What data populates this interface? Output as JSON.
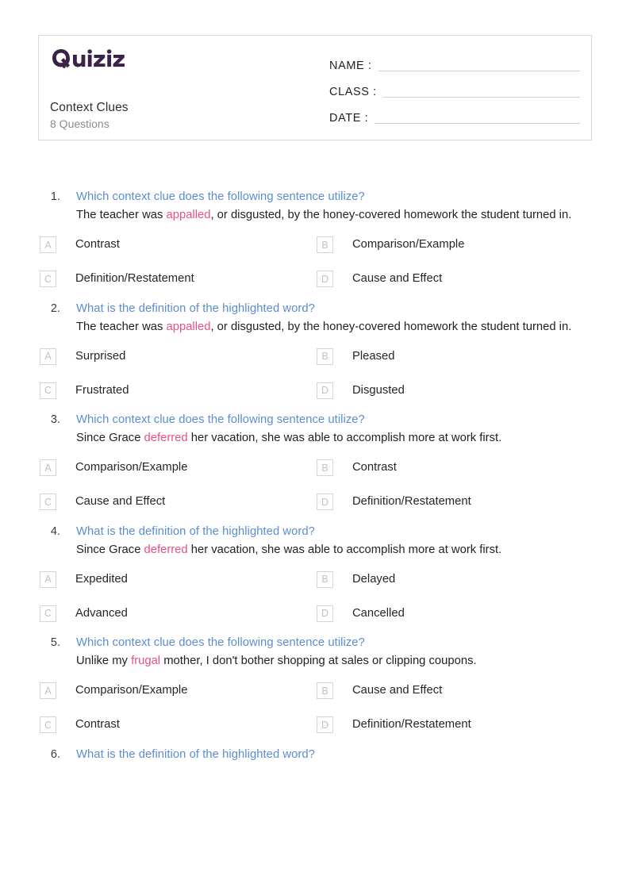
{
  "brand": {
    "logo_text": "Quizizz",
    "logo_color": "#3b2347"
  },
  "colors": {
    "question_title": "#5b8dd0",
    "highlight_word": "#ed4f81",
    "body_text": "#222222",
    "subtitle": "#8b8b8b",
    "option_letter": "#c2c2c2",
    "border": "#d8d8d8"
  },
  "header": {
    "quiz_title": "Context Clues",
    "question_count_label": "8 Questions",
    "fields": [
      {
        "label": "NAME :",
        "value": ""
      },
      {
        "label": "CLASS :",
        "value": ""
      },
      {
        "label": "DATE  :",
        "value": ""
      }
    ]
  },
  "questions": [
    {
      "number": "1.",
      "title": "Which context clue does the following sentence utilize?",
      "body_before": "The teacher was ",
      "body_highlight": "appalled",
      "body_after": ", or disgusted, by the honey-covered homework the student turned in.",
      "options": [
        {
          "letter": "A",
          "label": "Contrast"
        },
        {
          "letter": "B",
          "label": "Comparison/Example"
        },
        {
          "letter": "C",
          "label": "Definition/Restatement"
        },
        {
          "letter": "D",
          "label": "Cause and Effect"
        }
      ]
    },
    {
      "number": "2.",
      "title": "What is the definition of the highlighted word?",
      "body_before": "The teacher was ",
      "body_highlight": "appalled",
      "body_after": ", or disgusted, by the honey-covered homework the student turned in.",
      "options": [
        {
          "letter": "A",
          "label": "Surprised"
        },
        {
          "letter": "B",
          "label": "Pleased"
        },
        {
          "letter": "C",
          "label": "Frustrated"
        },
        {
          "letter": "D",
          "label": "Disgusted"
        }
      ]
    },
    {
      "number": "3.",
      "title": "Which context clue does the following sentence utilize?",
      "body_before": "Since Grace ",
      "body_highlight": "deferred",
      "body_after": " her vacation, she was able to accomplish more at work first.",
      "options": [
        {
          "letter": "A",
          "label": "Comparison/Example"
        },
        {
          "letter": "B",
          "label": "Contrast"
        },
        {
          "letter": "C",
          "label": "Cause and Effect"
        },
        {
          "letter": "D",
          "label": "Definition/Restatement"
        }
      ]
    },
    {
      "number": "4.",
      "title": "What is the definition of the highlighted word?",
      "body_before": "Since Grace ",
      "body_highlight": "deferred",
      "body_after": " her vacation, she was able to accomplish more at work first.",
      "options": [
        {
          "letter": "A",
          "label": "Expedited"
        },
        {
          "letter": "B",
          "label": "Delayed"
        },
        {
          "letter": "C",
          "label": "Advanced"
        },
        {
          "letter": "D",
          "label": "Cancelled"
        }
      ]
    },
    {
      "number": "5.",
      "title": "Which context clue does the following sentence utilize?",
      "body_before": "Unlike my ",
      "body_highlight": "frugal",
      "body_after": " mother, I don't bother shopping at sales or clipping coupons.",
      "options": [
        {
          "letter": "A",
          "label": "Comparison/Example"
        },
        {
          "letter": "B",
          "label": "Cause and Effect"
        },
        {
          "letter": "C",
          "label": "Contrast"
        },
        {
          "letter": "D",
          "label": "Definition/Restatement"
        }
      ]
    },
    {
      "number": "6.",
      "title": "What is the definition of the highlighted word?",
      "body_before": "",
      "body_highlight": "",
      "body_after": "",
      "options": []
    }
  ]
}
